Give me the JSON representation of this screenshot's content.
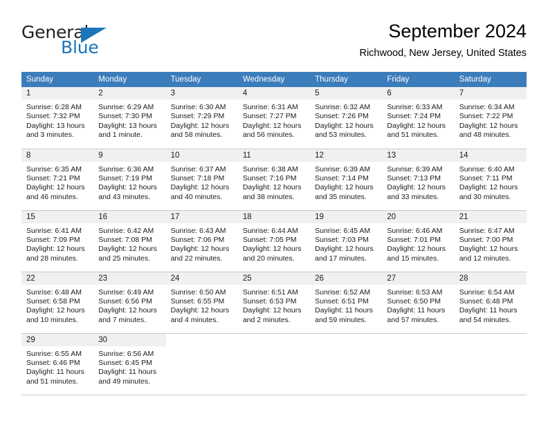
{
  "brand": {
    "name_top": "General",
    "name_bottom": "Blue",
    "accent_color": "#1b75bb",
    "text_color": "#231f20"
  },
  "header": {
    "title": "September 2024",
    "subtitle": "Richwood, New Jersey, United States"
  },
  "calendar": {
    "header_bg": "#3b7cbb",
    "header_text_color": "#ffffff",
    "daynum_bg": "#f0f0f0",
    "grid_line_color": "#c8c8c8",
    "weekday_headers": [
      "Sunday",
      "Monday",
      "Tuesday",
      "Wednesday",
      "Thursday",
      "Friday",
      "Saturday"
    ],
    "weeks": [
      [
        {
          "day": "1",
          "sunrise": "Sunrise: 6:28 AM",
          "sunset": "Sunset: 7:32 PM",
          "daylight_line1": "Daylight: 13 hours",
          "daylight_line2": "and 3 minutes."
        },
        {
          "day": "2",
          "sunrise": "Sunrise: 6:29 AM",
          "sunset": "Sunset: 7:30 PM",
          "daylight_line1": "Daylight: 13 hours",
          "daylight_line2": "and 1 minute."
        },
        {
          "day": "3",
          "sunrise": "Sunrise: 6:30 AM",
          "sunset": "Sunset: 7:29 PM",
          "daylight_line1": "Daylight: 12 hours",
          "daylight_line2": "and 58 minutes."
        },
        {
          "day": "4",
          "sunrise": "Sunrise: 6:31 AM",
          "sunset": "Sunset: 7:27 PM",
          "daylight_line1": "Daylight: 12 hours",
          "daylight_line2": "and 56 minutes."
        },
        {
          "day": "5",
          "sunrise": "Sunrise: 6:32 AM",
          "sunset": "Sunset: 7:26 PM",
          "daylight_line1": "Daylight: 12 hours",
          "daylight_line2": "and 53 minutes."
        },
        {
          "day": "6",
          "sunrise": "Sunrise: 6:33 AM",
          "sunset": "Sunset: 7:24 PM",
          "daylight_line1": "Daylight: 12 hours",
          "daylight_line2": "and 51 minutes."
        },
        {
          "day": "7",
          "sunrise": "Sunrise: 6:34 AM",
          "sunset": "Sunset: 7:22 PM",
          "daylight_line1": "Daylight: 12 hours",
          "daylight_line2": "and 48 minutes."
        }
      ],
      [
        {
          "day": "8",
          "sunrise": "Sunrise: 6:35 AM",
          "sunset": "Sunset: 7:21 PM",
          "daylight_line1": "Daylight: 12 hours",
          "daylight_line2": "and 46 minutes."
        },
        {
          "day": "9",
          "sunrise": "Sunrise: 6:36 AM",
          "sunset": "Sunset: 7:19 PM",
          "daylight_line1": "Daylight: 12 hours",
          "daylight_line2": "and 43 minutes."
        },
        {
          "day": "10",
          "sunrise": "Sunrise: 6:37 AM",
          "sunset": "Sunset: 7:18 PM",
          "daylight_line1": "Daylight: 12 hours",
          "daylight_line2": "and 40 minutes."
        },
        {
          "day": "11",
          "sunrise": "Sunrise: 6:38 AM",
          "sunset": "Sunset: 7:16 PM",
          "daylight_line1": "Daylight: 12 hours",
          "daylight_line2": "and 38 minutes."
        },
        {
          "day": "12",
          "sunrise": "Sunrise: 6:39 AM",
          "sunset": "Sunset: 7:14 PM",
          "daylight_line1": "Daylight: 12 hours",
          "daylight_line2": "and 35 minutes."
        },
        {
          "day": "13",
          "sunrise": "Sunrise: 6:39 AM",
          "sunset": "Sunset: 7:13 PM",
          "daylight_line1": "Daylight: 12 hours",
          "daylight_line2": "and 33 minutes."
        },
        {
          "day": "14",
          "sunrise": "Sunrise: 6:40 AM",
          "sunset": "Sunset: 7:11 PM",
          "daylight_line1": "Daylight: 12 hours",
          "daylight_line2": "and 30 minutes."
        }
      ],
      [
        {
          "day": "15",
          "sunrise": "Sunrise: 6:41 AM",
          "sunset": "Sunset: 7:09 PM",
          "daylight_line1": "Daylight: 12 hours",
          "daylight_line2": "and 28 minutes."
        },
        {
          "day": "16",
          "sunrise": "Sunrise: 6:42 AM",
          "sunset": "Sunset: 7:08 PM",
          "daylight_line1": "Daylight: 12 hours",
          "daylight_line2": "and 25 minutes."
        },
        {
          "day": "17",
          "sunrise": "Sunrise: 6:43 AM",
          "sunset": "Sunset: 7:06 PM",
          "daylight_line1": "Daylight: 12 hours",
          "daylight_line2": "and 22 minutes."
        },
        {
          "day": "18",
          "sunrise": "Sunrise: 6:44 AM",
          "sunset": "Sunset: 7:05 PM",
          "daylight_line1": "Daylight: 12 hours",
          "daylight_line2": "and 20 minutes."
        },
        {
          "day": "19",
          "sunrise": "Sunrise: 6:45 AM",
          "sunset": "Sunset: 7:03 PM",
          "daylight_line1": "Daylight: 12 hours",
          "daylight_line2": "and 17 minutes."
        },
        {
          "day": "20",
          "sunrise": "Sunrise: 6:46 AM",
          "sunset": "Sunset: 7:01 PM",
          "daylight_line1": "Daylight: 12 hours",
          "daylight_line2": "and 15 minutes."
        },
        {
          "day": "21",
          "sunrise": "Sunrise: 6:47 AM",
          "sunset": "Sunset: 7:00 PM",
          "daylight_line1": "Daylight: 12 hours",
          "daylight_line2": "and 12 minutes."
        }
      ],
      [
        {
          "day": "22",
          "sunrise": "Sunrise: 6:48 AM",
          "sunset": "Sunset: 6:58 PM",
          "daylight_line1": "Daylight: 12 hours",
          "daylight_line2": "and 10 minutes."
        },
        {
          "day": "23",
          "sunrise": "Sunrise: 6:49 AM",
          "sunset": "Sunset: 6:56 PM",
          "daylight_line1": "Daylight: 12 hours",
          "daylight_line2": "and 7 minutes."
        },
        {
          "day": "24",
          "sunrise": "Sunrise: 6:50 AM",
          "sunset": "Sunset: 6:55 PM",
          "daylight_line1": "Daylight: 12 hours",
          "daylight_line2": "and 4 minutes."
        },
        {
          "day": "25",
          "sunrise": "Sunrise: 6:51 AM",
          "sunset": "Sunset: 6:53 PM",
          "daylight_line1": "Daylight: 12 hours",
          "daylight_line2": "and 2 minutes."
        },
        {
          "day": "26",
          "sunrise": "Sunrise: 6:52 AM",
          "sunset": "Sunset: 6:51 PM",
          "daylight_line1": "Daylight: 11 hours",
          "daylight_line2": "and 59 minutes."
        },
        {
          "day": "27",
          "sunrise": "Sunrise: 6:53 AM",
          "sunset": "Sunset: 6:50 PM",
          "daylight_line1": "Daylight: 11 hours",
          "daylight_line2": "and 57 minutes."
        },
        {
          "day": "28",
          "sunrise": "Sunrise: 6:54 AM",
          "sunset": "Sunset: 6:48 PM",
          "daylight_line1": "Daylight: 11 hours",
          "daylight_line2": "and 54 minutes."
        }
      ],
      [
        {
          "day": "29",
          "sunrise": "Sunrise: 6:55 AM",
          "sunset": "Sunset: 6:46 PM",
          "daylight_line1": "Daylight: 11 hours",
          "daylight_line2": "and 51 minutes."
        },
        {
          "day": "30",
          "sunrise": "Sunrise: 6:56 AM",
          "sunset": "Sunset: 6:45 PM",
          "daylight_line1": "Daylight: 11 hours",
          "daylight_line2": "and 49 minutes."
        },
        {
          "day": "",
          "sunrise": "",
          "sunset": "",
          "daylight_line1": "",
          "daylight_line2": ""
        },
        {
          "day": "",
          "sunrise": "",
          "sunset": "",
          "daylight_line1": "",
          "daylight_line2": ""
        },
        {
          "day": "",
          "sunrise": "",
          "sunset": "",
          "daylight_line1": "",
          "daylight_line2": ""
        },
        {
          "day": "",
          "sunrise": "",
          "sunset": "",
          "daylight_line1": "",
          "daylight_line2": ""
        },
        {
          "day": "",
          "sunrise": "",
          "sunset": "",
          "daylight_line1": "",
          "daylight_line2": ""
        }
      ]
    ]
  }
}
